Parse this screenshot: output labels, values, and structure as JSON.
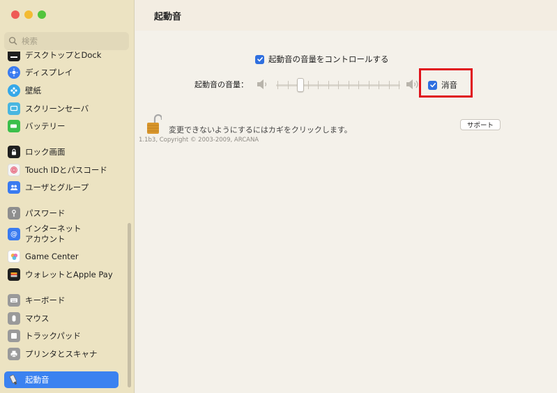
{
  "window": {
    "title": "起動音",
    "controls": [
      "close",
      "minimize",
      "zoom"
    ]
  },
  "sidebar": {
    "search_placeholder": "検索",
    "items": [
      {
        "label": "デスクトップとDock",
        "icon": "dock-icon",
        "color": "#1f1f1f"
      },
      {
        "label": "ディスプレイ",
        "icon": "display-icon",
        "color": "#3a7bf0"
      },
      {
        "label": "壁紙",
        "icon": "wallpaper-icon",
        "color": "#35a8e8"
      },
      {
        "label": "スクリーンセーバ",
        "icon": "screensaver-icon",
        "color": "#49b6e0"
      },
      {
        "label": "バッテリー",
        "icon": "battery-icon",
        "color": "#3cbf4b"
      },
      {
        "label": "ロック画面",
        "icon": "lock-screen-icon",
        "color": "#1f1f1f"
      },
      {
        "label": "Touch IDとパスコード",
        "icon": "fingerprint-icon",
        "color": "#f2f2f2"
      },
      {
        "label": "ユーザとグループ",
        "icon": "users-icon",
        "color": "#3a7bf0"
      },
      {
        "label": "パスワード",
        "icon": "key-icon",
        "color": "#8e8e8e"
      },
      {
        "label": "インターネット\nアカウント",
        "icon": "at-icon",
        "color": "#3a7bf0"
      },
      {
        "label": "Game Center",
        "icon": "game-center-icon",
        "color": "#ffffff"
      },
      {
        "label": "ウォレットとApple Pay",
        "icon": "wallet-icon",
        "color": "#1f1f1f"
      },
      {
        "label": "キーボード",
        "icon": "keyboard-icon",
        "color": "#9a9a9a"
      },
      {
        "label": "マウス",
        "icon": "mouse-icon",
        "color": "#9a9a9a"
      },
      {
        "label": "トラックパッド",
        "icon": "trackpad-icon",
        "color": "#9a9a9a"
      },
      {
        "label": "プリンタとスキャナ",
        "icon": "printer-icon",
        "color": "#9a9a9a"
      },
      {
        "label": "起動音",
        "icon": "startup-sound-icon",
        "color": "#ffffff",
        "selected": true
      }
    ]
  },
  "main": {
    "control_checkbox_label": "起動音の音量をコントロールする",
    "control_checked": true,
    "volume_label": "起動音の音量：",
    "volume_level": 0.18,
    "mute_label": "消音",
    "mute_checked": true,
    "lock_message": "変更できないようにするにはカギをクリックします。",
    "copyright": "1.1b3, Copyright © 2003-2009, ARCANA",
    "support_button": "サポート"
  },
  "colors": {
    "accent": "#2f6fdf",
    "sidebar_bg": "#ece3c2",
    "highlight": "#e0121b"
  }
}
